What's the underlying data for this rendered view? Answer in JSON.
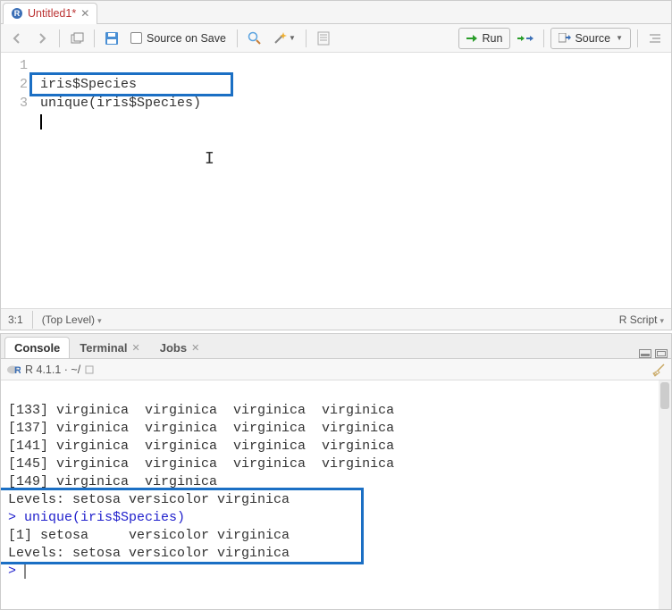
{
  "source": {
    "tab_title": "Untitled1*",
    "toolbar": {
      "source_on_save": "Source on Save",
      "run": "Run",
      "source_btn": "Source"
    },
    "code_lines": {
      "l1": "iris$Species",
      "l2": "unique(iris$Species)",
      "l3": ""
    },
    "status": {
      "pos": "3:1",
      "scope": "(Top Level)",
      "lang": "R Script"
    }
  },
  "console": {
    "tabs": {
      "console": "Console",
      "terminal": "Terminal",
      "jobs": "Jobs"
    },
    "info": "R 4.1.1 · ~/",
    "output": {
      "l1": "[133] virginica  virginica  virginica  virginica",
      "l2": "[137] virginica  virginica  virginica  virginica",
      "l3": "[141] virginica  virginica  virginica  virginica",
      "l4": "[145] virginica  virginica  virginica  virginica",
      "l5": "[149] virginica  virginica",
      "l6": "Levels: setosa versicolor virginica",
      "cmd": "> unique(iris$Species)",
      "res1": "[1] setosa     versicolor virginica",
      "res2": "Levels: setosa versicolor virginica",
      "prompt": "> "
    }
  }
}
